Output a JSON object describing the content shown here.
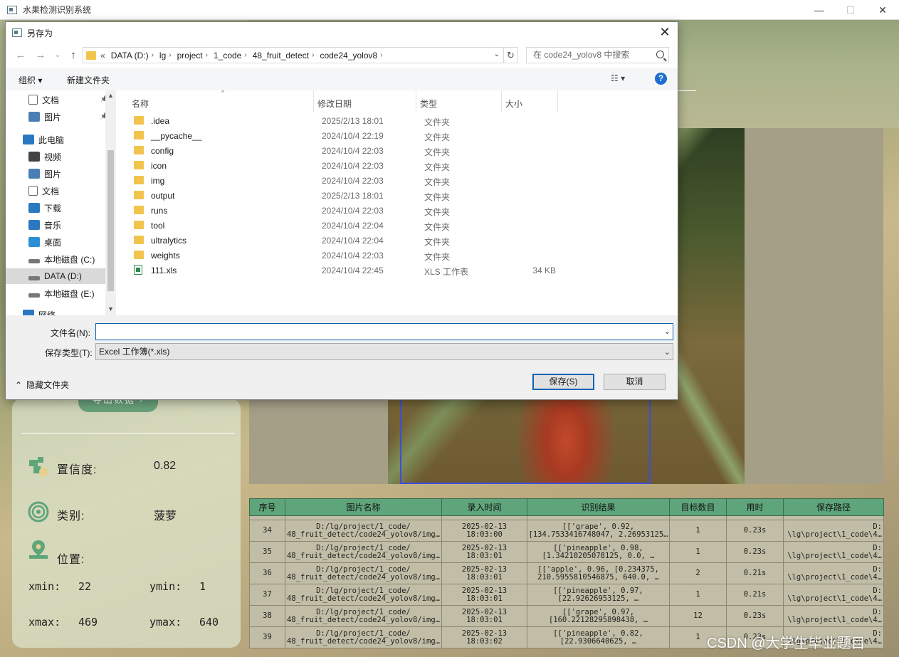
{
  "app": {
    "title": "水果检测识别系统",
    "export_label": "导出数据"
  },
  "dialog": {
    "title": "另存为",
    "address": {
      "prefix": "«",
      "segments": [
        "DATA (D:)",
        "lg",
        "project",
        "1_code",
        "48_fruit_detect",
        "code24_yolov8"
      ]
    },
    "search_placeholder": "在 code24_yolov8 中搜索",
    "organize": "组织 ▾",
    "new_folder": "新建文件夹",
    "nav": [
      {
        "label": "文档",
        "icon": "document-icon",
        "pinned": true
      },
      {
        "label": "图片",
        "icon": "pictures-icon",
        "pinned": true
      },
      {
        "label": "此电脑",
        "icon": "computer-icon"
      },
      {
        "label": "视频",
        "icon": "video-icon"
      },
      {
        "label": "图片",
        "icon": "pictures-icon"
      },
      {
        "label": "文档",
        "icon": "document-icon"
      },
      {
        "label": "下载",
        "icon": "download-icon"
      },
      {
        "label": "音乐",
        "icon": "music-icon"
      },
      {
        "label": "桌面",
        "icon": "desktop-icon"
      },
      {
        "label": "本地磁盘 (C:)",
        "icon": "drive-icon"
      },
      {
        "label": "DATA (D:)",
        "icon": "drive-icon",
        "selected": true
      },
      {
        "label": "本地磁盘 (E:)",
        "icon": "drive-icon"
      },
      {
        "label": "网络",
        "icon": "network-icon"
      }
    ],
    "columns": {
      "name": "名称",
      "date": "修改日期",
      "type": "类型",
      "size": "大小"
    },
    "files": [
      {
        "name": ".idea",
        "date": "2025/2/13 18:01",
        "type": "文件夹",
        "size": ""
      },
      {
        "name": "__pycache__",
        "date": "2024/10/4 22:19",
        "type": "文件夹",
        "size": ""
      },
      {
        "name": "config",
        "date": "2024/10/4 22:03",
        "type": "文件夹",
        "size": ""
      },
      {
        "name": "icon",
        "date": "2024/10/4 22:03",
        "type": "文件夹",
        "size": ""
      },
      {
        "name": "img",
        "date": "2024/10/4 22:03",
        "type": "文件夹",
        "size": ""
      },
      {
        "name": "output",
        "date": "2025/2/13 18:01",
        "type": "文件夹",
        "size": ""
      },
      {
        "name": "runs",
        "date": "2024/10/4 22:03",
        "type": "文件夹",
        "size": ""
      },
      {
        "name": "tool",
        "date": "2024/10/4 22:04",
        "type": "文件夹",
        "size": ""
      },
      {
        "name": "ultralytics",
        "date": "2024/10/4 22:04",
        "type": "文件夹",
        "size": ""
      },
      {
        "name": "weights",
        "date": "2024/10/4 22:03",
        "type": "文件夹",
        "size": ""
      },
      {
        "name": "111.xls",
        "date": "2024/10/4 22:45",
        "type": "XLS 工作表",
        "size": "34 KB",
        "xls": true
      }
    ],
    "filename_label": "文件名(N):",
    "filename_value": "",
    "filetype_label": "保存类型(T):",
    "filetype_value": "Excel 工作簿(*.xls)",
    "hide_folders": "隐藏文件夹",
    "save": "保存(S)",
    "cancel": "取消"
  },
  "info": {
    "confidence_label": "置信度:",
    "confidence_value": "0.82",
    "class_label": "类别:",
    "class_value": "菠萝",
    "position_label": "位置:",
    "xmin_label": "xmin:",
    "xmin": "22",
    "ymin_label": "ymin:",
    "ymin": "1",
    "xmax_label": "xmax:",
    "xmax": "469",
    "ymax_label": "ymax:",
    "ymax": "640"
  },
  "table": {
    "headers": [
      "序号",
      "图片名称",
      "录入时间",
      "识别结果",
      "目标数目",
      "用时",
      "保存路径"
    ],
    "rows": [
      {
        "id": "34",
        "image": "D:/lg/project/1_code/\n48_fruit_detect/code24_yolov8/img…",
        "time": "2025-02-13\n18:03:00",
        "result": "[['grape', 0.92,\n[134.7533416748047, 2.26953125…",
        "count": "1",
        "duration": "0.23s",
        "path": "D:\n\\lg\\project\\1_code\\4…"
      },
      {
        "id": "35",
        "image": "D:/lg/project/1_code/\n48_fruit_detect/code24_yolov8/img…",
        "time": "2025-02-13\n18:03:01",
        "result": "[['pineapple', 0.98,\n[1.34210205078125, 0.0, …",
        "count": "1",
        "duration": "0.23s",
        "path": "D:\n\\lg\\project\\1_code\\4…"
      },
      {
        "id": "36",
        "image": "D:/lg/project/1_code/\n48_fruit_detect/code24_yolov8/img…",
        "time": "2025-02-13\n18:03:01",
        "result": "[['apple', 0.96, [0.234375,\n210.5955810546875, 640.0, …",
        "count": "2",
        "duration": "0.21s",
        "path": "D:\n\\lg\\project\\1_code\\4…"
      },
      {
        "id": "37",
        "image": "D:/lg/project/1_code/\n48_fruit_detect/code24_yolov8/img…",
        "time": "2025-02-13\n18:03:01",
        "result": "[['pineapple', 0.97,\n[22.92626953125, …",
        "count": "1",
        "duration": "0.21s",
        "path": "D:\n\\lg\\project\\1_code\\4…"
      },
      {
        "id": "38",
        "image": "D:/lg/project/1_code/\n48_fruit_detect/code24_yolov8/img…",
        "time": "2025-02-13\n18:03:01",
        "result": "[['grape', 0.97,\n[160.22128295898438, …",
        "count": "12",
        "duration": "0.23s",
        "path": "D:\n\\lg\\project\\1_code\\4…"
      },
      {
        "id": "39",
        "image": "D:/lg/project/1_code/\n48_fruit_detect/code24_yolov8/img…",
        "time": "2025-02-13\n18:03:02",
        "result": "[['pineapple', 0.82,\n[22.9306640625, …",
        "count": "1",
        "duration": "0.23s",
        "path": "D:\n\\lg\\project\\1_code\\4…"
      }
    ]
  },
  "watermark": "CSDN @大学生毕业题目",
  "colors": {
    "accent": "#0a64b4",
    "table_header": "#5fa57b",
    "bbox": "#3b4fd8",
    "folder": "#f2c44d"
  }
}
